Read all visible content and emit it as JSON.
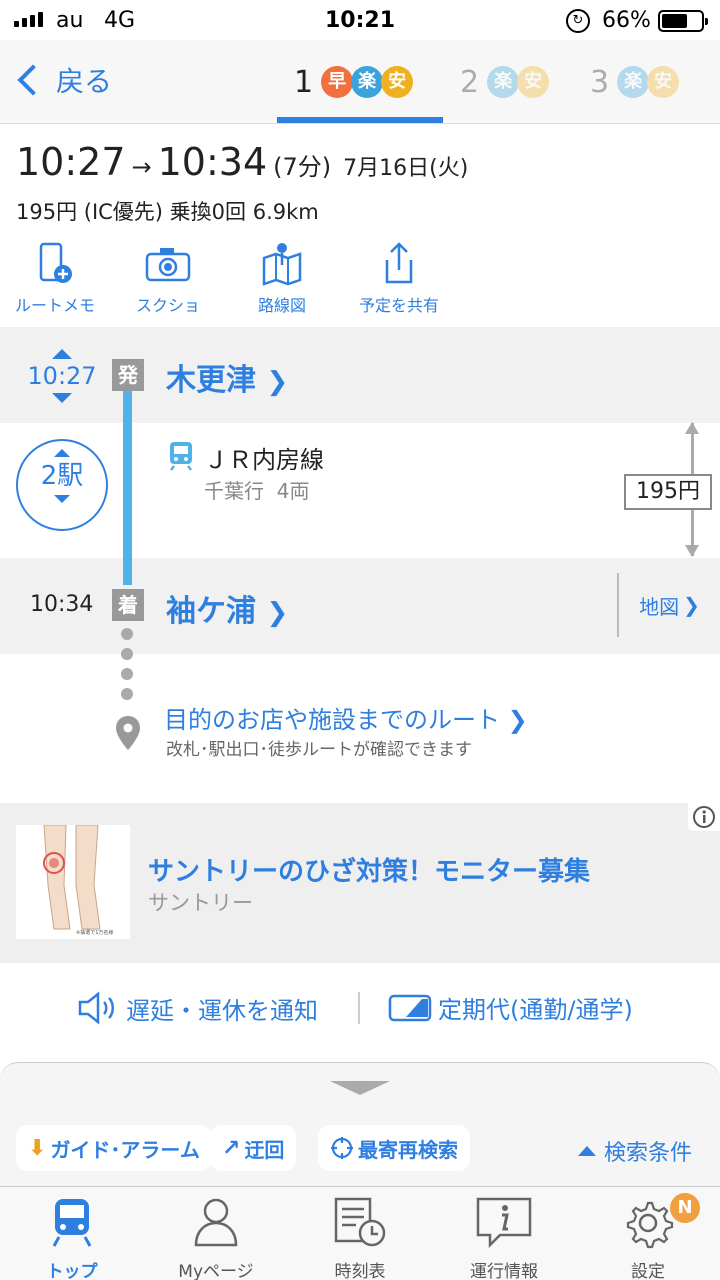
{
  "status_bar": {
    "carrier": "au",
    "network": "4G",
    "time": "10:21",
    "battery": "66%"
  },
  "header": {
    "back_label": "戻る",
    "route_tabs": [
      {
        "number": "1",
        "badges": [
          "早",
          "楽",
          "安"
        ]
      },
      {
        "number": "2",
        "badges": [
          "楽",
          "安"
        ]
      },
      {
        "number": "3",
        "badges": [
          "楽",
          "安"
        ]
      }
    ]
  },
  "summary": {
    "depart": "10:27",
    "arrow": "→",
    "arrive": "10:34",
    "duration": "(7分)",
    "date": "7月16日(火)",
    "meta": "195円 (IC優先) 乗換0回 6.9km"
  },
  "actions": [
    {
      "label": "ルートメモ",
      "icon": "phone-plus-icon"
    },
    {
      "label": "スクショ",
      "icon": "camera-icon"
    },
    {
      "label": "路線図",
      "icon": "map-pin-icon"
    },
    {
      "label": "予定を共有",
      "icon": "share-icon"
    }
  ],
  "route": {
    "departure": {
      "time": "10:27",
      "badge": "発",
      "station": "木更津"
    },
    "segment": {
      "stops": "2駅",
      "line": "ＪＲ内房線",
      "detail": "千葉行  4両",
      "fare": "195円"
    },
    "arrival": {
      "time": "10:34",
      "badge": "着",
      "station": "袖ケ浦",
      "map_label": "地図"
    },
    "destination": {
      "title": "目的のお店や施設までのルート",
      "subtitle": "改札･駅出口･徒歩ルートが確認できます"
    }
  },
  "ad": {
    "title": "サントリーのひざ対策！モニター募集",
    "sponsor": "サントリー",
    "image_caption": "※抽選で1万名様"
  },
  "links": {
    "notify": "遅延・運休を通知",
    "pass": "定期代(通勤/通学)"
  },
  "drawer": {
    "guide": "ガイド･アラーム",
    "detour": "迂回",
    "nearest": "最寄再検索",
    "conditions": "検索条件"
  },
  "tabbar": [
    {
      "label": "トップ",
      "icon": "train-icon"
    },
    {
      "label": "Myページ",
      "icon": "person-icon"
    },
    {
      "label": "時刻表",
      "icon": "timetable-icon"
    },
    {
      "label": "運行情報",
      "icon": "info-icon"
    },
    {
      "label": "設定",
      "icon": "gear-icon",
      "badge": "N"
    }
  ],
  "colors": {
    "accent": "#2f7fe0",
    "line": "#4fb3ea",
    "badge_fast": "#f07040",
    "badge_easy": "#3aa3dc",
    "badge_cheap": "#f0b020",
    "notify_badge": "#f0a040"
  }
}
